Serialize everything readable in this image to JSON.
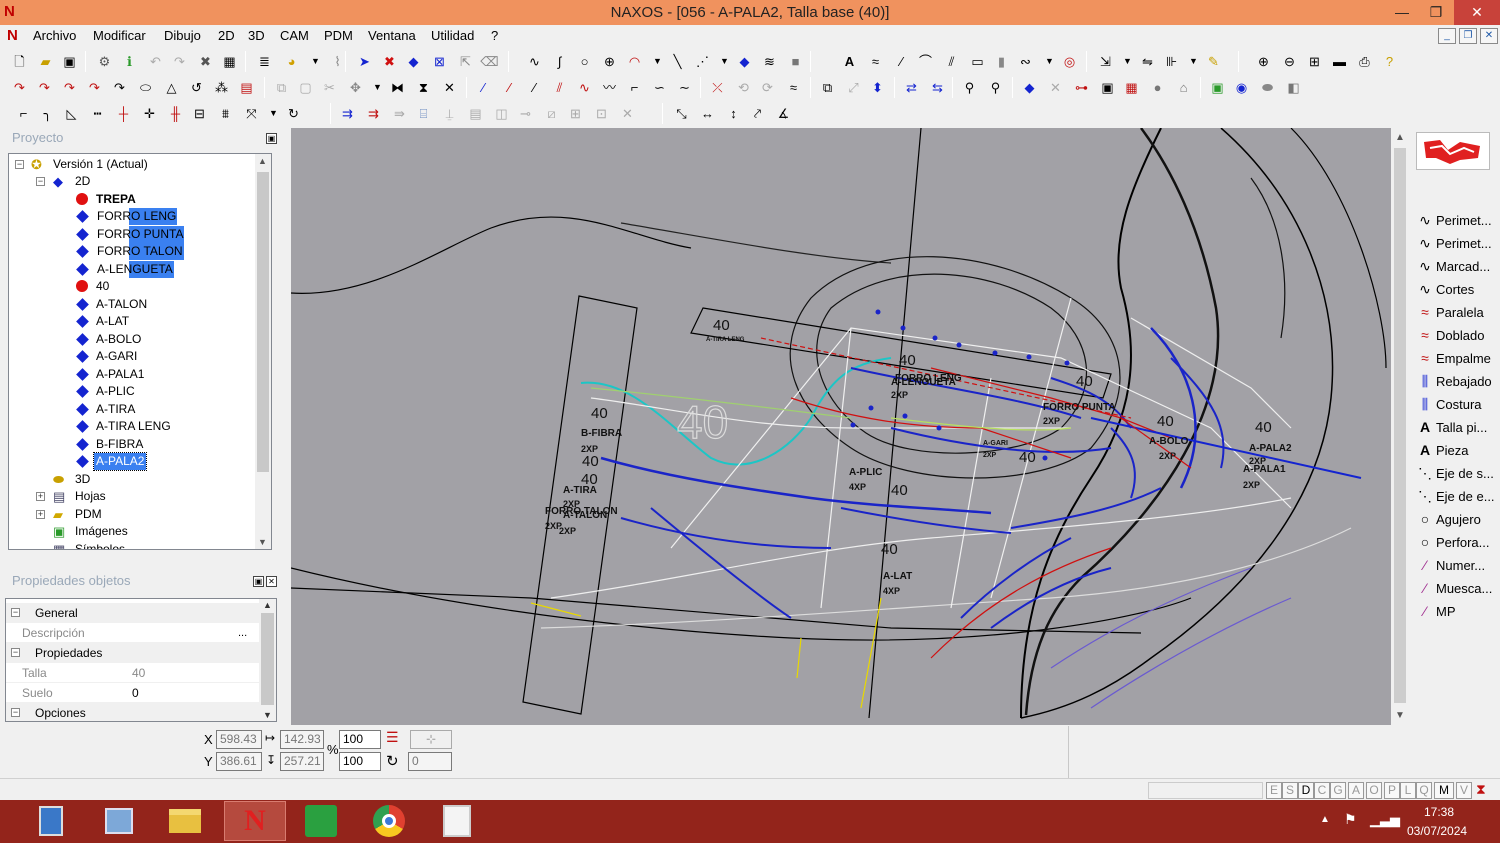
{
  "window": {
    "title": "NAXOS - [056 - A-PALA2, Talla base (40)]",
    "minimize": "—",
    "restore": "❐",
    "close": "✕"
  },
  "menu": {
    "items": [
      "Archivo",
      "Modificar",
      "Dibujo",
      "2D",
      "3D",
      "CAM",
      "PDM",
      "Ventana",
      "Utilidad",
      "?"
    ],
    "mdi_buttons": [
      "_",
      "❐",
      "✕"
    ]
  },
  "project_panel": {
    "title": "Proyecto",
    "tree": [
      {
        "label": "Versión 1 (Actual)",
        "icon": "version-icon",
        "expander": "−"
      },
      {
        "label": "2D",
        "icon": "2d-icon",
        "expander": "−"
      },
      {
        "label": "TREPA",
        "icon": "red-dot-icon",
        "bold": true
      },
      {
        "label": "FORRO LENG",
        "icon": "blue-diamond-icon"
      },
      {
        "label": "FORRO PUNTA",
        "icon": "blue-diamond-icon"
      },
      {
        "label": "FORRO TALON",
        "icon": "blue-diamond-icon"
      },
      {
        "label": "A-LENGUETA",
        "icon": "blue-diamond-icon"
      },
      {
        "label": "40",
        "icon": "red-dot-icon"
      },
      {
        "label": "A-TALON",
        "icon": "blue-diamond-icon"
      },
      {
        "label": "A-LAT",
        "icon": "blue-diamond-icon"
      },
      {
        "label": "A-BOLO",
        "icon": "blue-diamond-icon"
      },
      {
        "label": "A-GARI",
        "icon": "blue-diamond-icon"
      },
      {
        "label": "A-PALA1",
        "icon": "blue-diamond-icon"
      },
      {
        "label": "A-PLIC",
        "icon": "blue-diamond-icon"
      },
      {
        "label": "A-TIRA",
        "icon": "blue-diamond-icon"
      },
      {
        "label": "A-TIRA LENG",
        "icon": "blue-diamond-icon"
      },
      {
        "label": "B-FIBRA",
        "icon": "blue-diamond-icon"
      },
      {
        "label": "A-PALA2",
        "icon": "blue-diamond-icon",
        "selected": true
      },
      {
        "label": "3D",
        "icon": "3d-icon"
      },
      {
        "label": "Hojas",
        "icon": "sheets-icon",
        "expander": "+"
      },
      {
        "label": "PDM",
        "icon": "folder-icon",
        "expander": "+"
      },
      {
        "label": "Imágenes",
        "icon": "images-icon"
      },
      {
        "label": "Símbolos",
        "icon": "symbols-icon"
      }
    ]
  },
  "properties_panel": {
    "title": "Propiedades objetos",
    "rows": [
      {
        "type": "category",
        "name": "General",
        "expander": "−"
      },
      {
        "type": "prop",
        "name": "Descripción",
        "value": "",
        "button": "..."
      },
      {
        "type": "category",
        "name": "Propiedades",
        "expander": "−"
      },
      {
        "type": "prop",
        "name": "Talla",
        "value": "40",
        "disabled": true
      },
      {
        "type": "prop",
        "name": "Suelo",
        "value": "0"
      },
      {
        "type": "category",
        "name": "Opciones",
        "expander": "−"
      }
    ]
  },
  "coords": {
    "x_label": "X",
    "y_label": "Y",
    "x": "598.43",
    "y": "386.61",
    "width": "142.93",
    "height": "257.21",
    "scale_x": "100",
    "scale_y": "100",
    "percent": "%",
    "rotation": "0"
  },
  "drawing_labels": {
    "big_size": "40",
    "sizes": [
      "40",
      "40",
      "40",
      "40",
      "40",
      "40",
      "40",
      "40",
      "40",
      "40",
      "40"
    ],
    "pieces": [
      "A-TIRA LENG",
      "FORRO LENG",
      "A-LENGUETA",
      "FORRO PUNTA",
      "A-BOLO",
      "A-PALA2",
      "A-PALA1",
      "A-GARI",
      "A-PLIC",
      "A-LAT",
      "B-FIBRA",
      "A-TIRA",
      "A-TALON",
      "FORRO TALON"
    ],
    "quantities": [
      "2XP",
      "2XP",
      "2XP",
      "2XP",
      "2XP",
      "2XP",
      "4XP",
      "4XP",
      "2XP",
      "2XP",
      "2XP",
      "2XP"
    ]
  },
  "right_panel": {
    "items": [
      {
        "label": "Perimet...",
        "icon": "perimeter-icon"
      },
      {
        "label": "Perimet...",
        "icon": "perimeter-icon"
      },
      {
        "label": "Marcad...",
        "icon": "marker-icon"
      },
      {
        "label": "Cortes",
        "icon": "cuts-icon"
      },
      {
        "label": "Paralela",
        "icon": "parallel-icon"
      },
      {
        "label": "Doblado",
        "icon": "fold-icon"
      },
      {
        "label": "Empalme",
        "icon": "splice-icon"
      },
      {
        "label": "Rebajado",
        "icon": "skive-icon"
      },
      {
        "label": "Costura",
        "icon": "seam-icon"
      },
      {
        "label": "Talla pi...",
        "icon": "size-text-icon"
      },
      {
        "label": "Pieza",
        "icon": "piece-text-icon"
      },
      {
        "label": "Eje de s...",
        "icon": "axis-icon"
      },
      {
        "label": "Eje de e...",
        "icon": "axis-icon"
      },
      {
        "label": "Agujero",
        "icon": "hole-icon"
      },
      {
        "label": "Perfora...",
        "icon": "perforation-icon"
      },
      {
        "label": "Numer...",
        "icon": "numbering-icon"
      },
      {
        "label": "Muesca...",
        "icon": "notch-icon"
      },
      {
        "label": "MP",
        "icon": "mp-icon"
      }
    ]
  },
  "statusbar": {
    "letters": [
      "E",
      "S",
      "D",
      "C",
      "G",
      "A",
      "O",
      "P",
      "L",
      "Q",
      "M",
      "V"
    ]
  },
  "taskbar": {
    "time": "17:38",
    "date": "03/07/2024",
    "apps": [
      "calculator-icon",
      "explorer-icon",
      "folder-icon",
      "naxos-icon",
      "app-icon",
      "chrome-icon",
      "presentation-icon"
    ]
  },
  "colors": {
    "titlebar": "#f0925e",
    "canvas": "#a2a1a6",
    "selection": "#3a80f0",
    "taskbar": "#93241b"
  }
}
